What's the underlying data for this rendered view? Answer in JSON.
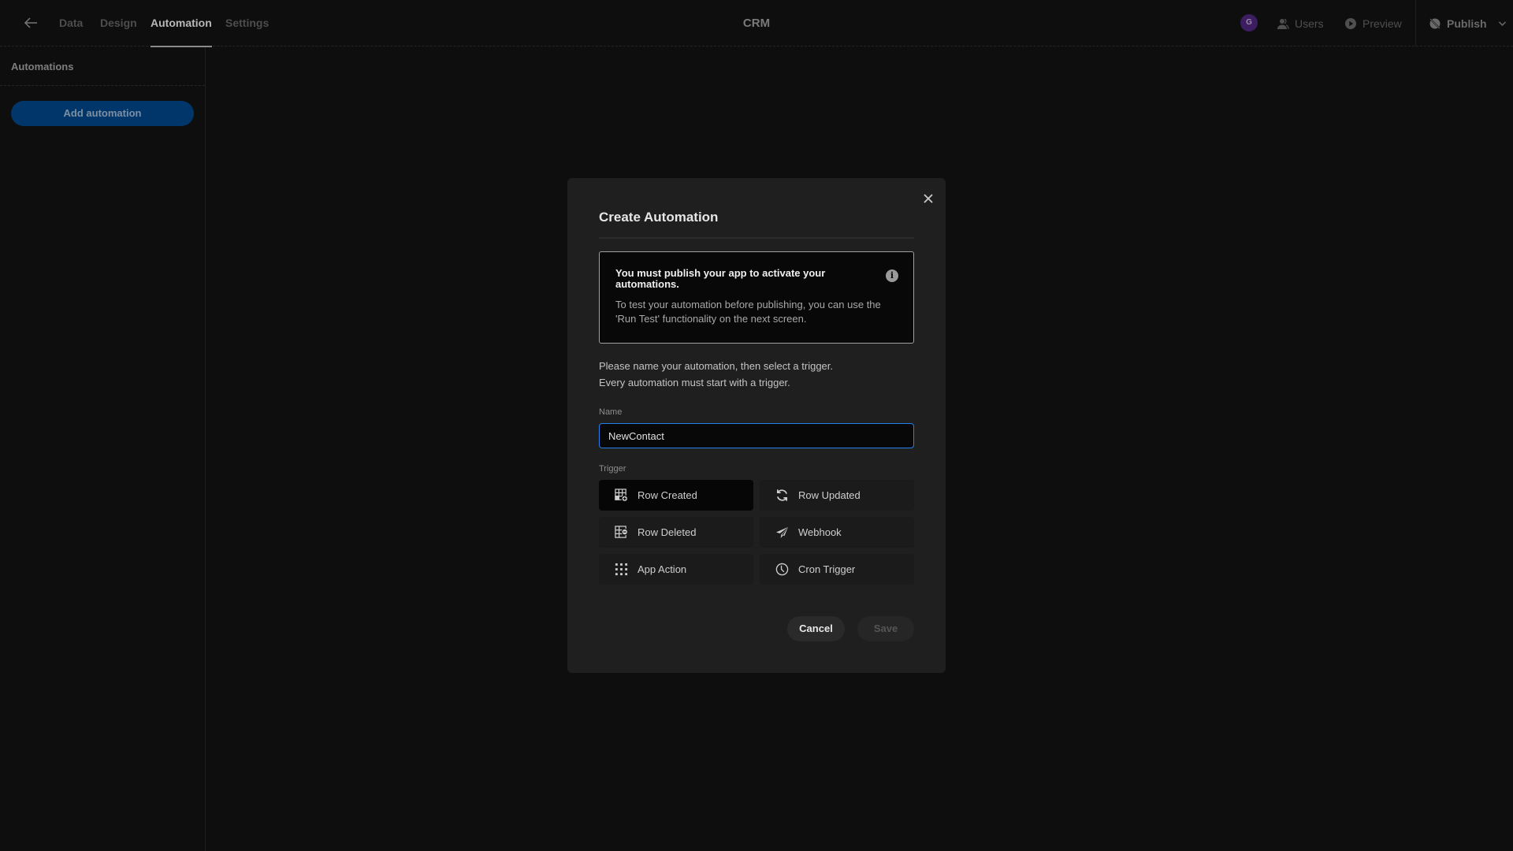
{
  "topbar": {
    "back_icon": "arrow-left-icon",
    "tabs": [
      {
        "label": "Data",
        "active": false
      },
      {
        "label": "Design",
        "active": false
      },
      {
        "label": "Automation",
        "active": true
      },
      {
        "label": "Settings",
        "active": false
      }
    ],
    "app_title": "CRM",
    "avatar_initial": "G",
    "avatar_color": "#3b1d60",
    "users_label": "Users",
    "preview_label": "Preview",
    "publish_label": "Publish"
  },
  "sidebar": {
    "heading": "Automations",
    "add_button": "Add automation",
    "accent": "#00366a"
  },
  "background": {
    "partial_heading": "s"
  },
  "modal": {
    "title": "Create Automation",
    "info": {
      "title": "You must publish your app to activate your automations.",
      "body": "To test your automation before publishing, you can use the 'Run Test' functionality on the next screen."
    },
    "description_line1": "Please name your automation, then select a trigger.",
    "description_line2": "Every automation must start with a trigger.",
    "name_label": "Name",
    "name_value": "NewContact",
    "trigger_label": "Trigger",
    "triggers": [
      {
        "label": "Row Created",
        "icon": "table-row-add-icon",
        "selected": true
      },
      {
        "label": "Row Updated",
        "icon": "refresh-icon",
        "selected": false
      },
      {
        "label": "Row Deleted",
        "icon": "table-row-remove-icon",
        "selected": false
      },
      {
        "label": "Webhook",
        "icon": "send-icon",
        "selected": false
      },
      {
        "label": "App Action",
        "icon": "dots-grid-icon",
        "selected": false
      },
      {
        "label": "Cron Trigger",
        "icon": "clock-icon",
        "selected": false
      }
    ],
    "cancel_label": "Cancel",
    "save_label": "Save",
    "focus_color": "#2680eb"
  }
}
